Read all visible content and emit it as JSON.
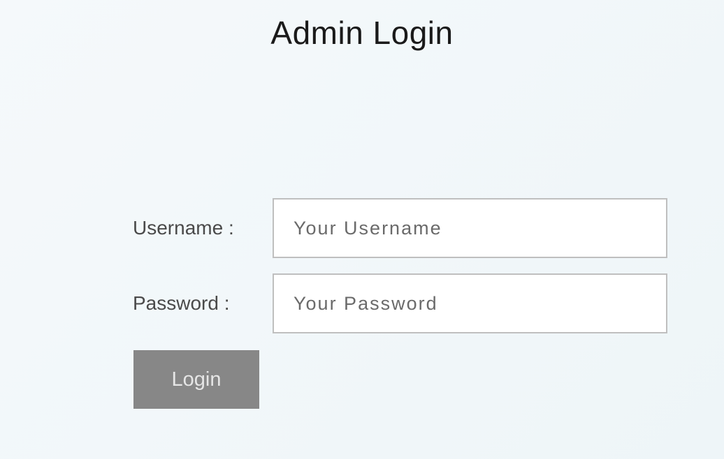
{
  "page": {
    "title": "Admin Login"
  },
  "form": {
    "username": {
      "label": "Username :",
      "placeholder": "Your Username",
      "value": ""
    },
    "password": {
      "label": "Password :",
      "placeholder": "Your Password",
      "value": ""
    },
    "submit_label": "Login"
  },
  "colors": {
    "button_bg": "#878787",
    "input_border": "#bfbfbf",
    "text_dark": "#1a1a1a",
    "text_medium": "#4a4a4a"
  }
}
